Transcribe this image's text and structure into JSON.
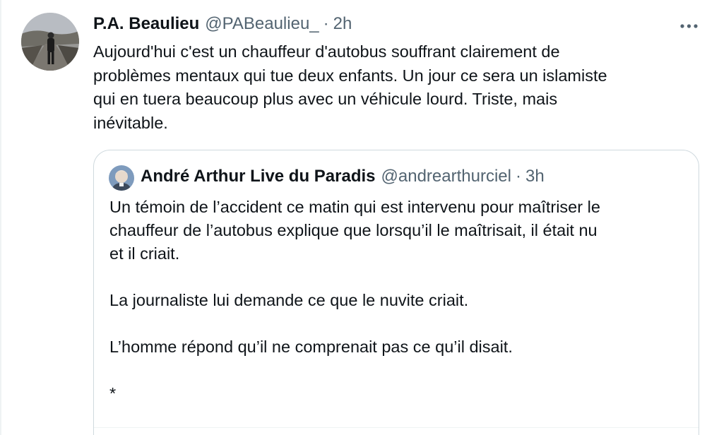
{
  "tweet": {
    "author_name": "P.A. Beaulieu",
    "author_handle": "@PABeaulieu_",
    "separator": "·",
    "time": "2h",
    "text": "Aujourd'hui c'est un chauffeur d'autobus souffrant clairement de\nproblèmes mentaux qui tue deux enfants. Un jour ce sera un islamiste\nqui en tuera beaucoup plus avec un véhicule lourd. Triste, mais\ninévitable.",
    "more_icon": "more-horizontal-icon"
  },
  "quoted_tweet": {
    "author_name": "André Arthur Live du Paradis",
    "author_handle": "@andrearthurciel",
    "separator": "·",
    "time": "3h",
    "text": "Un témoin de l’accident ce matin qui est intervenu pour maîtriser le\nchauffeur de l’autobus explique que lorsqu’il le maîtrisait, il était nu\net il criait.\n\nLa journaliste lui demande ce que le nuvite criait.\n\nL’homme répond qu’il ne comprenait pas ce qu’il disait.\n\n*"
  },
  "colors": {
    "primary_text": "#0f1419",
    "secondary_text": "#536471",
    "border": "#cfd9de"
  }
}
